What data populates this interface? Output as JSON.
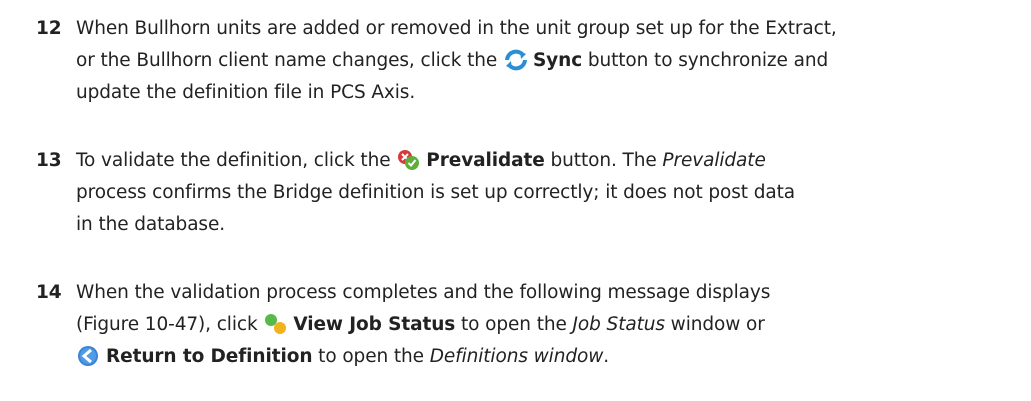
{
  "steps": [
    {
      "number": "12",
      "line1": "When Bullhorn units are added or removed in the unit group set up for the Extract,",
      "line2_pre": "or the Bullhorn client name changes, click the ",
      "sync_label": "Sync",
      "line2_post": " button to synchronize and",
      "line3": "update the definition file in PCS Axis.",
      "icon": "sync-icon"
    },
    {
      "number": "13",
      "line1_pre": "To validate the definition, click the ",
      "prevalidate_label": "Prevalidate",
      "line1_mid": " button. The ",
      "line1_italic": "Prevalidate",
      "line2": "process confirms the Bridge definition is set up correctly; it does not post data",
      "line3": "in the database.",
      "icon": "prevalidate-icon"
    },
    {
      "number": "14",
      "line1": "When the validation process completes and the following message displays",
      "line2_pre": "(Figure 10-47), click ",
      "view_job_label": "View Job Status",
      "line2_mid": " to open the ",
      "line2_italic": "Job Status",
      "line2_post": " window or",
      "return_label": "Return to Definition",
      "line3_mid": " to open the ",
      "line3_italic": "Definitions window",
      "line3_post": ".",
      "icons": [
        "job-status-icon",
        "return-icon"
      ]
    }
  ]
}
